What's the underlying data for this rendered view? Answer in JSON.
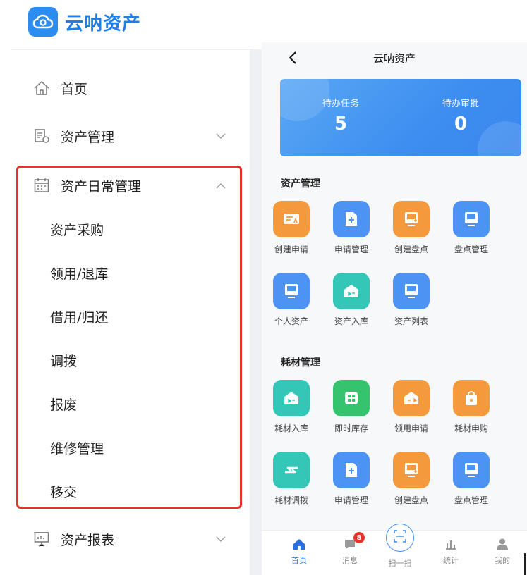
{
  "brand": {
    "name": "云呐资产"
  },
  "sidebar": {
    "items": [
      {
        "label": "首页",
        "icon": "home-icon"
      },
      {
        "label": "资产管理",
        "icon": "asset-doc-icon",
        "expanded": false
      },
      {
        "label": "资产日常管理",
        "icon": "calendar-icon",
        "expanded": true,
        "children": [
          "资产采购",
          "领用/退库",
          "借用/归还",
          "调拨",
          "报废",
          "维修管理",
          "移交"
        ]
      },
      {
        "label": "资产报表",
        "icon": "report-board-icon",
        "expanded": false
      }
    ],
    "highlight_color": "#e8322a"
  },
  "phone": {
    "title": "云呐资产",
    "stats": [
      {
        "label": "待办任务",
        "value": "5"
      },
      {
        "label": "待办审批",
        "value": "0"
      }
    ],
    "sections": [
      {
        "title": "资产管理",
        "tiles": [
          {
            "label": "创建申请",
            "color": "#f59a3c",
            "icon": "apply-card-icon"
          },
          {
            "label": "申请管理",
            "color": "#4d93f3",
            "icon": "doc-plus-icon"
          },
          {
            "label": "创建盘点",
            "color": "#f59a3c",
            "icon": "inventory-plus-icon"
          },
          {
            "label": "盘点管理",
            "color": "#4d93f3",
            "icon": "inventory-icon"
          },
          {
            "label": "个人资产",
            "color": "#4d93f3",
            "icon": "device-icon"
          },
          {
            "label": "资产入库",
            "color": "#34c6b7",
            "icon": "warehouse-in-icon"
          },
          {
            "label": "资产列表",
            "color": "#4d93f3",
            "icon": "device-list-icon"
          }
        ]
      },
      {
        "title": "耗材管理",
        "tiles": [
          {
            "label": "耗材入库",
            "color": "#34c6b7",
            "icon": "warehouse-in-icon"
          },
          {
            "label": "即时库存",
            "color": "#35c46d",
            "icon": "grid-stock-icon"
          },
          {
            "label": "领用申请",
            "color": "#f59a3c",
            "icon": "warehouse-out-icon"
          },
          {
            "label": "耗材申购",
            "color": "#f59a3c",
            "icon": "bag-icon"
          },
          {
            "label": "耗材调拨",
            "color": "#34c6b7",
            "icon": "swap-arrows-icon"
          },
          {
            "label": "申请管理",
            "color": "#4d93f3",
            "icon": "doc-plus-icon"
          },
          {
            "label": "创建盘点",
            "color": "#f59a3c",
            "icon": "inventory-plus-icon"
          },
          {
            "label": "盘点管理",
            "color": "#4d93f3",
            "icon": "inventory-icon"
          }
        ]
      }
    ],
    "tabbar": [
      {
        "label": "首页",
        "icon": "home-filled-icon",
        "active": true
      },
      {
        "label": "消息",
        "icon": "message-icon",
        "badge": "8"
      },
      {
        "label": "扫一扫",
        "icon": "scan-icon"
      },
      {
        "label": "统计",
        "icon": "stats-icon"
      },
      {
        "label": "我的",
        "icon": "user-icon"
      }
    ],
    "accent": "#3d8ef0"
  }
}
